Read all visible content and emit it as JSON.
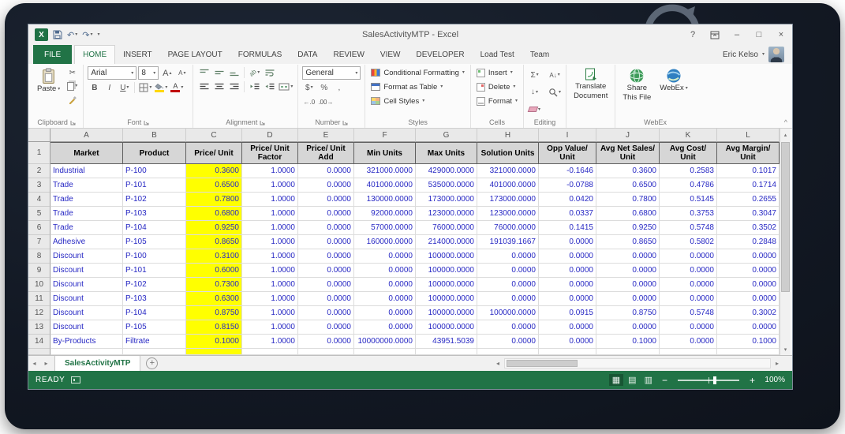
{
  "colors": {
    "accent": "#217346",
    "highlight": "#ffff00",
    "data_text": "#2829c4"
  },
  "window": {
    "title": "SalesActivityMTP - Excel",
    "controls": {
      "help": "?",
      "minimize": "–",
      "maximize": "□",
      "close": "×"
    }
  },
  "ribbon": {
    "tabs": [
      {
        "label": "FILE",
        "type": "file"
      },
      {
        "label": "HOME",
        "active": true
      },
      {
        "label": "INSERT"
      },
      {
        "label": "PAGE LAYOUT"
      },
      {
        "label": "FORMULAS"
      },
      {
        "label": "DATA"
      },
      {
        "label": "REVIEW"
      },
      {
        "label": "VIEW"
      },
      {
        "label": "DEVELOPER"
      },
      {
        "label": "Load Test"
      },
      {
        "label": "Team"
      }
    ],
    "user": "Eric Kelso",
    "groups": {
      "clipboard": {
        "label": "Clipboard",
        "paste": "Paste"
      },
      "font": {
        "label": "Font",
        "name": "Arial",
        "size": "8",
        "bold": "B",
        "italic": "I",
        "underline": "U"
      },
      "alignment": {
        "label": "Alignment"
      },
      "number": {
        "label": "Number",
        "format": "General",
        "currency": "$",
        "percent": "%",
        "comma": ","
      },
      "styles": {
        "label": "Styles",
        "conditional": "Conditional Formatting",
        "table": "Format as Table",
        "cellstyles": "Cell Styles"
      },
      "cells": {
        "label": "Cells",
        "insert": "Insert",
        "delete": "Delete",
        "format": "Format"
      },
      "editing": {
        "label": "Editing"
      },
      "translate": {
        "line1": "Translate",
        "line2": "Document"
      },
      "webex": {
        "label": "WebEx",
        "share_line1": "Share",
        "share_line2": "This File",
        "webex": "WebEx"
      }
    }
  },
  "sheet": {
    "column_letters": [
      "A",
      "B",
      "C",
      "D",
      "E",
      "F",
      "G",
      "H",
      "I",
      "J",
      "K",
      "L"
    ],
    "headers": [
      "Market",
      "Product",
      "Price/ Unit",
      "Price/ Unit Factor",
      "Price/ Unit Add",
      "Min Units",
      "Max Units",
      "Solution Units",
      "Opp Value/ Unit",
      "Avg Net Sales/ Unit",
      "Avg Cost/ Unit",
      "Avg Margin/ Unit"
    ],
    "highlight_column": 2,
    "rows": [
      {
        "n": "2",
        "cells": [
          "Industrial",
          "P-100",
          "0.3600",
          "1.0000",
          "0.0000",
          "321000.0000",
          "429000.0000",
          "321000.0000",
          "-0.1646",
          "0.3600",
          "0.2583",
          "0.1017"
        ]
      },
      {
        "n": "3",
        "cells": [
          "Trade",
          "P-101",
          "0.6500",
          "1.0000",
          "0.0000",
          "401000.0000",
          "535000.0000",
          "401000.0000",
          "-0.0788",
          "0.6500",
          "0.4786",
          "0.1714"
        ]
      },
      {
        "n": "4",
        "cells": [
          "Trade",
          "P-102",
          "0.7800",
          "1.0000",
          "0.0000",
          "130000.0000",
          "173000.0000",
          "173000.0000",
          "0.0420",
          "0.7800",
          "0.5145",
          "0.2655"
        ]
      },
      {
        "n": "5",
        "cells": [
          "Trade",
          "P-103",
          "0.6800",
          "1.0000",
          "0.0000",
          "92000.0000",
          "123000.0000",
          "123000.0000",
          "0.0337",
          "0.6800",
          "0.3753",
          "0.3047"
        ]
      },
      {
        "n": "6",
        "cells": [
          "Trade",
          "P-104",
          "0.9250",
          "1.0000",
          "0.0000",
          "57000.0000",
          "76000.0000",
          "76000.0000",
          "0.1415",
          "0.9250",
          "0.5748",
          "0.3502"
        ]
      },
      {
        "n": "7",
        "cells": [
          "Adhesive",
          "P-105",
          "0.8650",
          "1.0000",
          "0.0000",
          "160000.0000",
          "214000.0000",
          "191039.1667",
          "0.0000",
          "0.8650",
          "0.5802",
          "0.2848"
        ]
      },
      {
        "n": "8",
        "cells": [
          "Discount",
          "P-100",
          "0.3100",
          "1.0000",
          "0.0000",
          "0.0000",
          "100000.0000",
          "0.0000",
          "0.0000",
          "0.0000",
          "0.0000",
          "0.0000"
        ]
      },
      {
        "n": "9",
        "cells": [
          "Discount",
          "P-101",
          "0.6000",
          "1.0000",
          "0.0000",
          "0.0000",
          "100000.0000",
          "0.0000",
          "0.0000",
          "0.0000",
          "0.0000",
          "0.0000"
        ]
      },
      {
        "n": "10",
        "cells": [
          "Discount",
          "P-102",
          "0.7300",
          "1.0000",
          "0.0000",
          "0.0000",
          "100000.0000",
          "0.0000",
          "0.0000",
          "0.0000",
          "0.0000",
          "0.0000"
        ]
      },
      {
        "n": "11",
        "cells": [
          "Discount",
          "P-103",
          "0.6300",
          "1.0000",
          "0.0000",
          "0.0000",
          "100000.0000",
          "0.0000",
          "0.0000",
          "0.0000",
          "0.0000",
          "0.0000"
        ]
      },
      {
        "n": "12",
        "cells": [
          "Discount",
          "P-104",
          "0.8750",
          "1.0000",
          "0.0000",
          "0.0000",
          "100000.0000",
          "100000.0000",
          "0.0915",
          "0.8750",
          "0.5748",
          "0.3002"
        ]
      },
      {
        "n": "13",
        "cells": [
          "Discount",
          "P-105",
          "0.8150",
          "1.0000",
          "0.0000",
          "0.0000",
          "100000.0000",
          "0.0000",
          "0.0000",
          "0.0000",
          "0.0000",
          "0.0000"
        ]
      },
      {
        "n": "14",
        "cells": [
          "By-Products",
          "Filtrate",
          "0.1000",
          "1.0000",
          "0.0000",
          "10000000.0000",
          "43951.5039",
          "0.0000",
          "0.0000",
          "0.1000",
          "0.0000",
          "0.1000"
        ]
      }
    ]
  },
  "sheet_tabs": {
    "active": "SalesActivityMTP"
  },
  "status_bar": {
    "mode": "READY",
    "zoom": "100%"
  },
  "icons": {
    "excel_logo": "X",
    "dropdown": "▾",
    "undo": "↶",
    "redo": "↷",
    "scissors": "✂",
    "sigma": "Σ",
    "sort": "A↓",
    "fill_down": "↓",
    "letterA": "A",
    "ab": "ab",
    "inc_decimal": "←.0",
    "dec_decimal": ".00→",
    "collapse": "^",
    "chevron_left": "◂",
    "chevron_right": "▸",
    "chevron_up": "▴",
    "chevron_down": "▾",
    "plus": "+",
    "minus": "−",
    "view_normal": "▦",
    "view_layout": "▤",
    "view_break": "▥"
  }
}
